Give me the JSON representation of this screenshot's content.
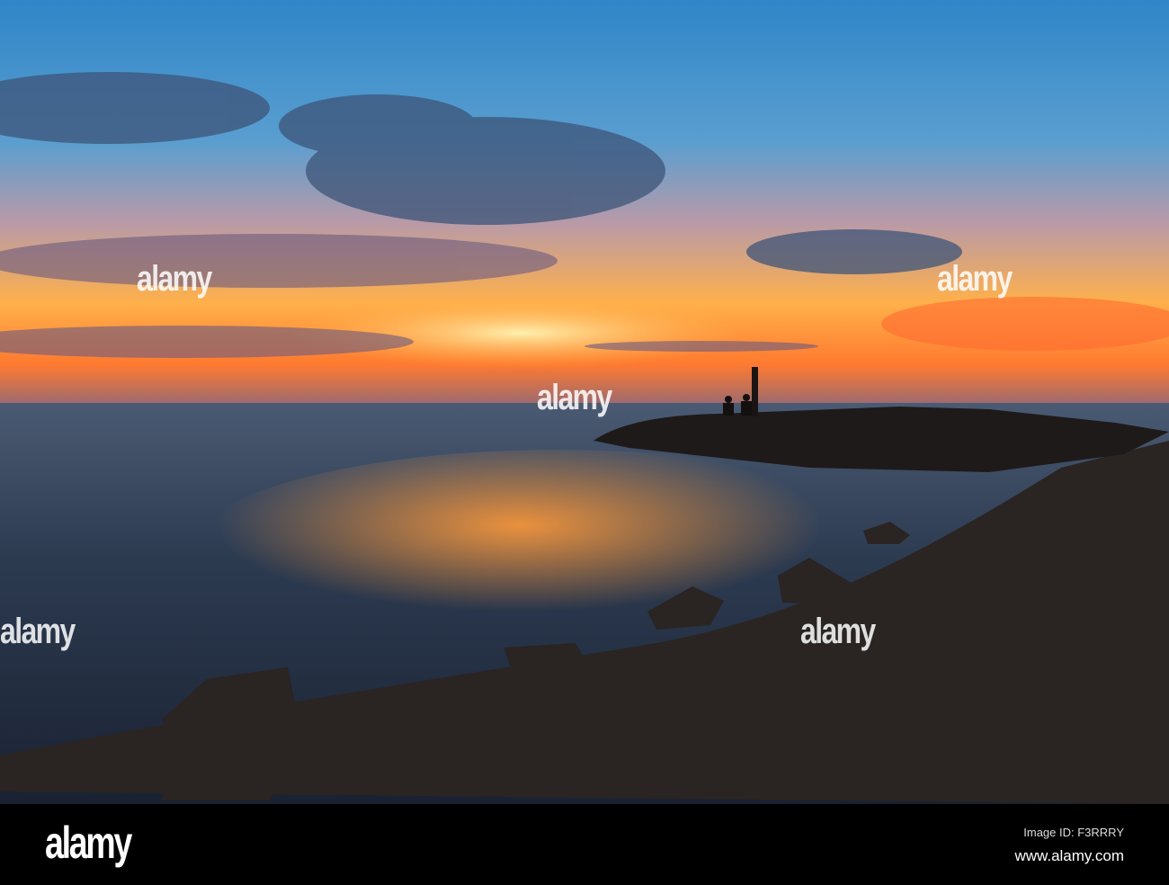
{
  "photo": {
    "subject": "Sunset over sea with rock jetty and fishermen",
    "watermark_text": "alamy"
  },
  "footer": {
    "logo": "alamy",
    "image_id": "Image ID: F3RRRY",
    "website": "www.alamy.com"
  },
  "colors": {
    "sky_top": "#3a8ccc",
    "sunset_orange": "#ff8a2a",
    "sea": "#2a3a52",
    "sand": "#2b2624"
  }
}
